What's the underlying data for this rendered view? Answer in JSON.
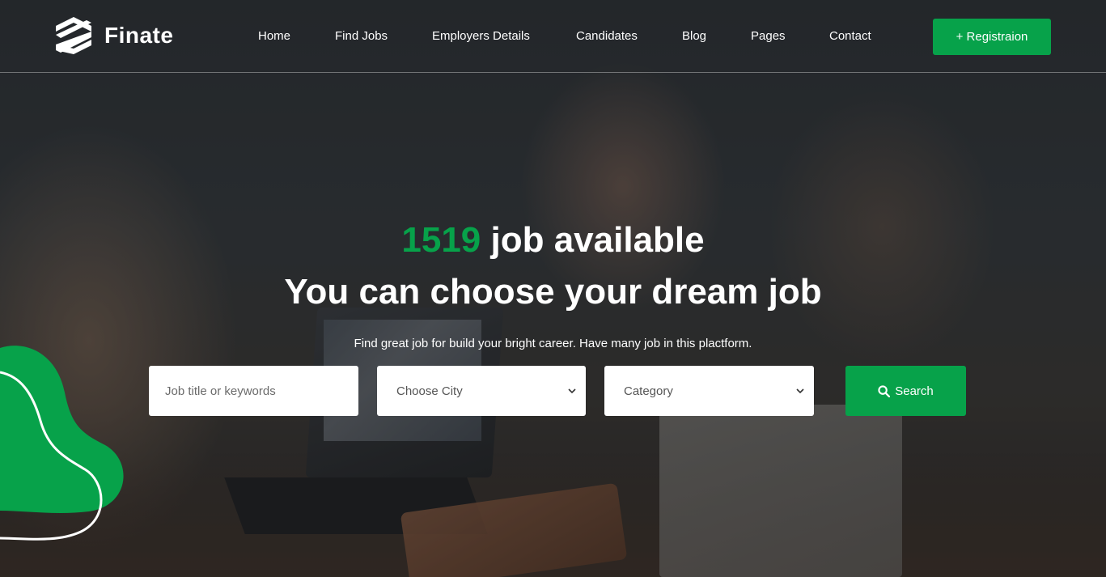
{
  "brand": {
    "name": "Finate",
    "logo_icon": "finate-logo-icon",
    "accent_color": "#07a24a"
  },
  "nav": {
    "items": [
      {
        "label": "Home"
      },
      {
        "label": "Find Jobs"
      },
      {
        "label": "Employers Details"
      },
      {
        "label": "Candidates"
      },
      {
        "label": "Blog"
      },
      {
        "label": "Pages"
      },
      {
        "label": "Contact"
      }
    ],
    "register_label": "+ Registraion"
  },
  "hero": {
    "job_count": "1519",
    "title_suffix": "job available",
    "headline": "You can choose your dream job",
    "subtitle": "Find great job for build your bright career. Have many job in this plactform."
  },
  "search": {
    "keyword_placeholder": "Job title or keywords",
    "city_select": {
      "selected": "Choose City"
    },
    "category_select": {
      "selected": "Category"
    },
    "button_label": "Search",
    "button_icon": "search-icon"
  }
}
